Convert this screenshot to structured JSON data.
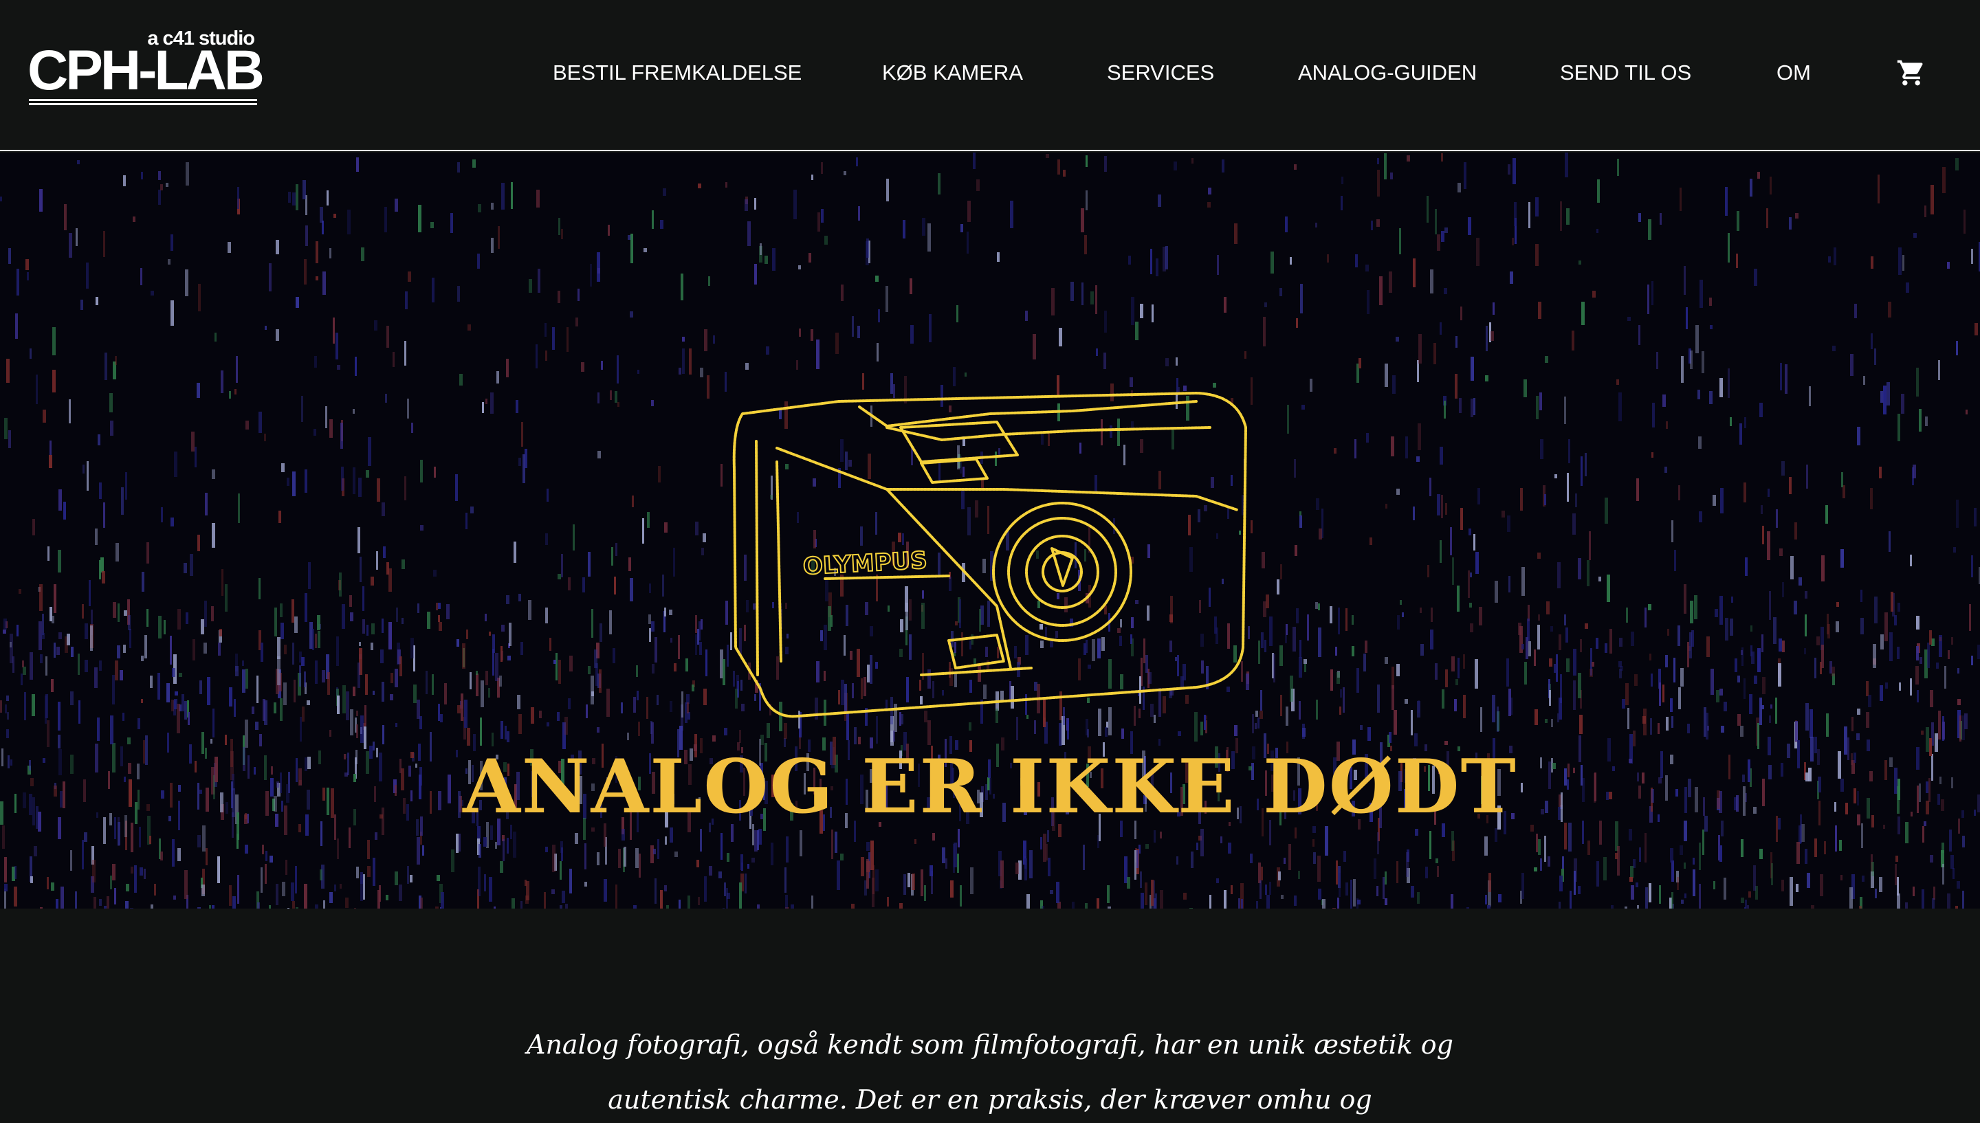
{
  "header": {
    "logo": {
      "subtitle": "a c41 studio",
      "name": "CPH-LAB"
    },
    "nav": [
      {
        "label": "BESTIL FREMKALDELSE"
      },
      {
        "label": "KØB KAMERA"
      },
      {
        "label": "SERVICES"
      },
      {
        "label": "ANALOG-GUIDEN"
      },
      {
        "label": "SEND TIL OS"
      },
      {
        "label": "OM"
      }
    ],
    "cart_icon": "shopping-cart-icon"
  },
  "hero": {
    "title": "ANALOG ER IKKE DØDT",
    "camera_brand": "OLYMPUS",
    "title_color": "#f2bf3e",
    "illustration_color": "#f5d23a"
  },
  "intro": {
    "line1": "Analog fotografi, også kendt som filmfotografi, har en unik æstetik og",
    "line2": "autentisk charme. Det er en praksis, der kræver omhu og"
  },
  "colors": {
    "background": "#111312",
    "text": "#ffffff",
    "accent": "#f2bf3e"
  }
}
